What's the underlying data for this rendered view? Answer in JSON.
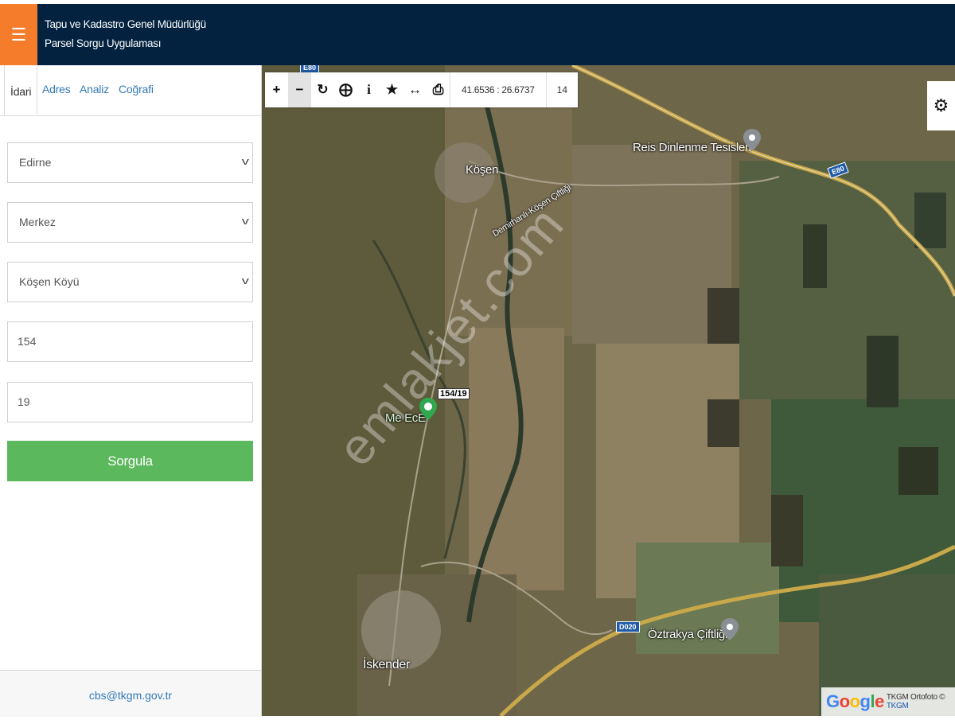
{
  "header": {
    "menu_icon": "hamburger-icon",
    "title_line1": "Tapu ve Kadastro Genel Müdürlüğü",
    "title_line2": "Parsel Sorgu Uygulaması",
    "bg_color": "#02223f",
    "accent_color": "#f57c2a"
  },
  "sidebar": {
    "tabs": [
      {
        "label": "İdari",
        "active": true
      },
      {
        "label": "Adres",
        "active": false
      },
      {
        "label": "Analiz",
        "active": false
      },
      {
        "label": "Coğrafi",
        "active": false
      }
    ],
    "province_select": "Edirne",
    "district_select": "Merkez",
    "neighborhood_select": "Köşen Köyü",
    "block_input": "154",
    "parcel_input": "19",
    "query_button": "Sorgula",
    "query_button_color": "#5cb85c",
    "footer_email": "cbs@tkgm.gov.tr"
  },
  "map": {
    "toolbar": {
      "tools": [
        "zoom-in-icon",
        "zoom-out-icon",
        "refresh-icon",
        "locate-icon",
        "info-icon",
        "favorite-icon",
        "measure-icon",
        "print-icon"
      ],
      "coordinates": "41.6536 : 26.6737",
      "zoom_level": "14"
    },
    "labels": {
      "village_kosen": "Köşen",
      "road_name": "Demirhanlı-Köşen Çiftliği",
      "rest_area": "Reis Dinlenme Tesisleri",
      "farm": "Öztrakya Çiftliği",
      "town": "İskender",
      "place_meece": "Me EcE",
      "parcel": "154/19",
      "road_e80": "E80",
      "road_d020": "D020"
    },
    "watermark": "emlakjet.com",
    "attribution": {
      "logo": "Google",
      "text": "TKGM Ortofoto © ",
      "link": "TKGM"
    }
  }
}
